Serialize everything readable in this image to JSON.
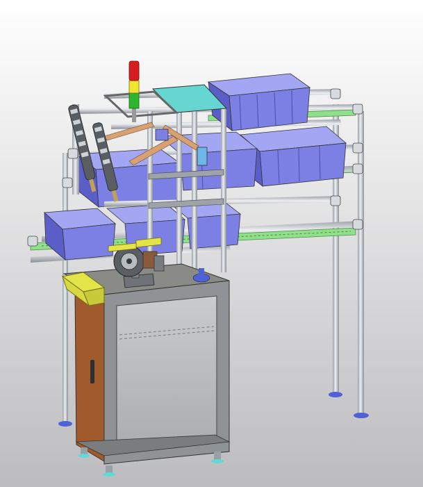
{
  "scene": {
    "background": {
      "top": "#ffffff",
      "bottom": "#bcbcbf"
    },
    "colors": {
      "tube": "#c8ccd2",
      "tube_dark": "#8d939c",
      "bin": "#7c7fe3",
      "bin_dark": "#5b5ec6",
      "bin_light": "#a3a6f2",
      "green_rail": "#8fe08a",
      "cabinet_top": "#8a8a87",
      "cabinet_front": "#b9bdbf",
      "cabinet_side": "#a05a2c",
      "yellow_part": "#e3e34a",
      "tower_red": "#d71d1d",
      "tower_yellow": "#f0e431",
      "tower_green": "#2db52d",
      "cyan_panel": "#65d7d0",
      "orange_brace": "#d9a172",
      "foot": "#4e62d6",
      "foot_cyan": "#62d9d4"
    }
  }
}
